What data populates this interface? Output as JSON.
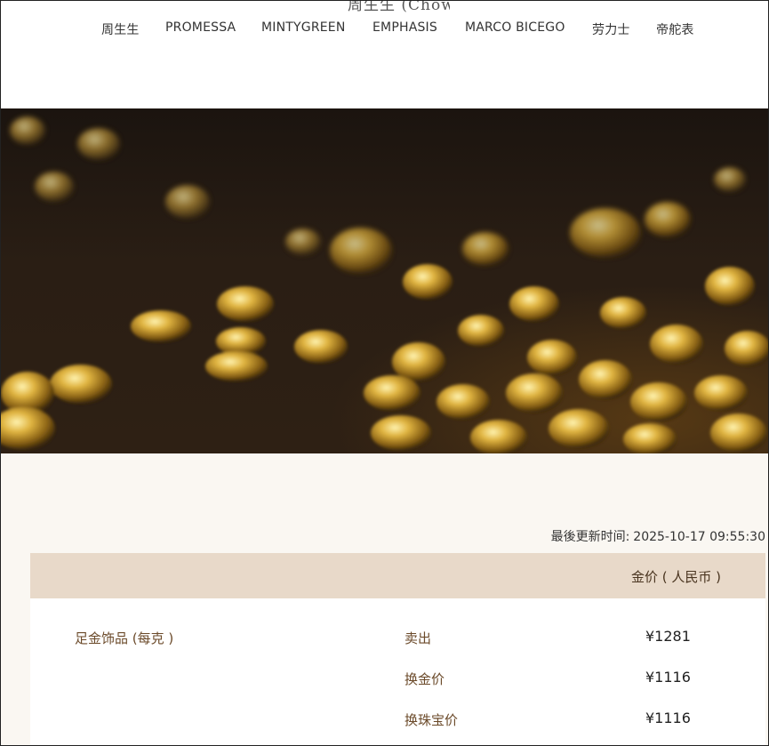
{
  "header": {
    "logo_text": "周生生 (Chow Sang Sang)",
    "nav": [
      {
        "label": "周生生"
      },
      {
        "label": "PROMESSA"
      },
      {
        "label": "MINTYGREEN"
      },
      {
        "label": "EMPHASIS"
      },
      {
        "label": "MARCO BICEGO"
      },
      {
        "label": "劳力士"
      },
      {
        "label": "帝舵表"
      }
    ]
  },
  "prices": {
    "updated_label": "最後更新时间:",
    "updated_value": "2025-10-17 09:55:30",
    "column_header": "金价 ( 人民币 )",
    "product": "足金饰品 (每克 )",
    "rows": [
      {
        "label": "卖出",
        "value": "¥1281"
      },
      {
        "label": "换金价",
        "value": "¥1116"
      },
      {
        "label": "换珠宝价",
        "value": "¥1116"
      }
    ]
  },
  "colors": {
    "header_bg": "#ffffff",
    "table_header_bg": "#e8d9c9",
    "content_bg": "#faf7f2",
    "label_brown": "#6b4a2a"
  }
}
